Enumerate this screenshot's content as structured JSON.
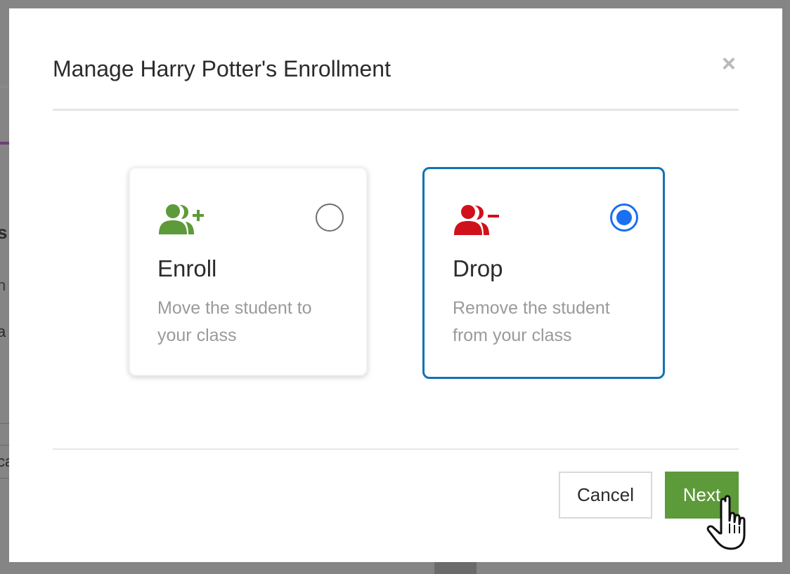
{
  "modal": {
    "title": "Manage Harry Potter's Enrollment",
    "close_glyph": "×"
  },
  "options": [
    {
      "title": "Enroll",
      "description": "Move the student to your class",
      "icon": "user-plus-icon",
      "icon_color": "#5d9a3a",
      "selected": false
    },
    {
      "title": "Drop",
      "description": "Remove the student from your class",
      "icon": "user-minus-icon",
      "icon_color": "#d0101b",
      "selected": true
    }
  ],
  "footer": {
    "cancel_label": "Cancel",
    "next_label": "Next"
  },
  "colors": {
    "accent_blue": "#1172b3",
    "radio_blue": "#1a6ff2",
    "next_green": "#5d9a3a"
  }
}
